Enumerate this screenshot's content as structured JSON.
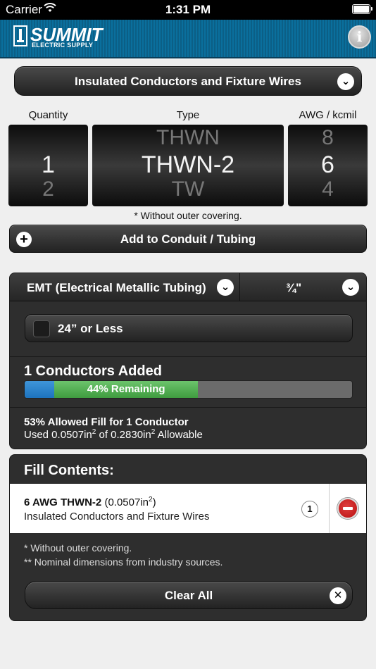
{
  "status_bar": {
    "carrier": "Carrier",
    "time": "1:31 PM"
  },
  "header": {
    "brand": "SUMMIT",
    "brand_sub": "ELECTRIC SUPPLY",
    "info_label": "i"
  },
  "category": {
    "label": "Insulated Conductors and Fixture Wires",
    "chevron": "⌄"
  },
  "columns": {
    "quantity": "Quantity",
    "type": "Type",
    "awg": "AWG / kcmil"
  },
  "pickers": {
    "quantity": {
      "prev": "",
      "current": "1",
      "next": "2"
    },
    "type": {
      "prev": "THWN",
      "current": "THWN-2",
      "next": "TW"
    },
    "awg": {
      "prev": "8",
      "current": "6",
      "next": "4"
    }
  },
  "without_covering_note": "* Without outer covering.",
  "add_button": {
    "label": "Add to Conduit / Tubing",
    "icon": "+"
  },
  "conduit": {
    "type": "EMT (Electrical Metallic Tubing)",
    "size": "¾\"",
    "length_option": "24” or Less",
    "conductors_added": "1 Conductors Added",
    "fill": {
      "used_fraction": 0.09,
      "remaining_fraction": 0.44,
      "remaining_label": "44% Remaining"
    },
    "allowed_fill": "53% Allowed Fill for 1 Conductor",
    "used_prefix": "Used 0.0507in",
    "used_mid": " of 0.2830in",
    "used_suffix": " Allowable",
    "sup": "2"
  },
  "contents": {
    "title": "Fill Contents:",
    "items": [
      {
        "name": "6 AWG THWN-2",
        "area": " (0.0507in",
        "area_close": ")",
        "sup": "2",
        "desc": "Insulated Conductors and Fixture Wires",
        "count": "1"
      }
    ],
    "footnote1": "* Without outer covering.",
    "footnote2": "** Nominal dimensions from industry sources.",
    "clear_label": "Clear All",
    "clear_icon": "✕"
  },
  "colors": {
    "header_blue": "#0a6f9d",
    "used_blue": "#1d73be",
    "remaining_green": "#4caf50",
    "remove_red": "#c8171d"
  }
}
